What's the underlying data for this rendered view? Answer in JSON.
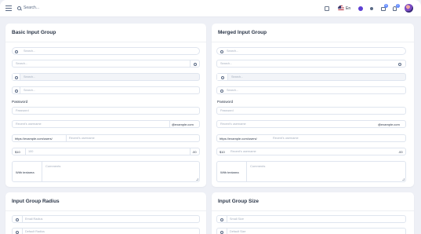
{
  "topbar": {
    "search_placeholder": "Search...",
    "language": "En",
    "cart_count": "5",
    "notification_count": "2"
  },
  "cards": {
    "basic": {
      "title": "Basic Input Group",
      "search1_placeholder": "Search...",
      "search2_placeholder": "Search...",
      "search3_placeholder": "Search...",
      "search4_placeholder": "Search...",
      "password_label": "Password",
      "password_placeholder": "Password",
      "username_placeholder": "Recent's username",
      "email_suffix": "@example.com",
      "url_prefix": "https://example.com/users/",
      "url_username_placeholder": "Recent's username",
      "currency_prefix": "$10",
      "amount_placeholder": "100",
      "cents_suffix": ".00",
      "textarea_addon": "With textarea",
      "textarea_placeholder": "Comments"
    },
    "merged": {
      "title": "Merged Input Group",
      "search1_placeholder": "Search...",
      "search2_placeholder": "Search...",
      "search3_placeholder": "Search...",
      "search4_placeholder": "Search...",
      "password_label": "Password",
      "password_placeholder": "Password",
      "username_placeholder": "Recent's username",
      "email_suffix": "@example.com",
      "url_prefix": "https://example.com/users/",
      "url_username_placeholder": "Recent's username",
      "currency_prefix": "$10",
      "amount_placeholder": "Recent's username",
      "cents_suffix": ".00",
      "textarea_addon": "With textarea",
      "textarea_placeholder": "Comments"
    },
    "radius": {
      "title": "Input Group Radius",
      "field1_placeholder": "Email Radius",
      "field2_placeholder": "Default Radius"
    },
    "size": {
      "title": "Input Group Size",
      "field1_placeholder": "Small Size",
      "field2_placeholder": "Default Size"
    }
  },
  "colors": {
    "accent": "#5d87ff",
    "background": "#eef0f6",
    "border": "#dfe5ef"
  },
  "icons": [
    "menu-icon",
    "search-icon",
    "grid-icon",
    "flag-icon",
    "theme-icon",
    "sun-icon",
    "cart-icon",
    "bell-icon",
    "gear-icon"
  ]
}
